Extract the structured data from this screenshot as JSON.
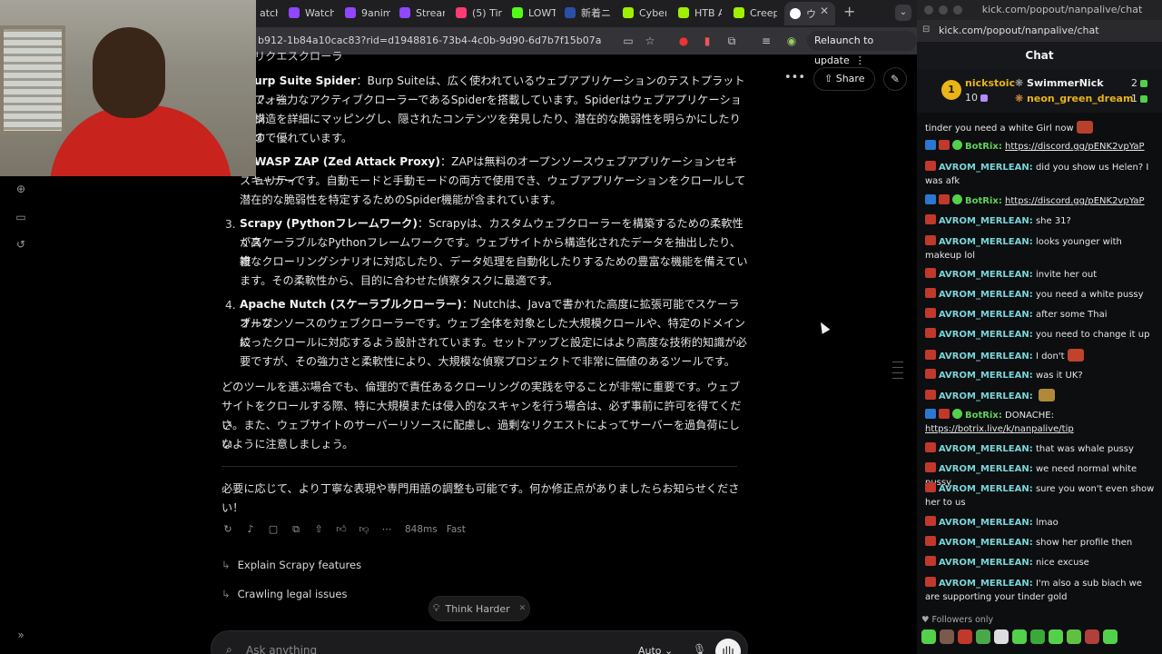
{
  "browser": {
    "tabs": [
      {
        "label": "atch",
        "icon": "youtube-icon",
        "color": "#ff0033"
      },
      {
        "label": "Watch",
        "icon": "twitch-icon",
        "color": "#9146ff"
      },
      {
        "label": "9anim",
        "icon": "twitch-icon",
        "color": "#9146ff"
      },
      {
        "label": "Stream",
        "icon": "twitch-icon",
        "color": "#9146ff"
      },
      {
        "label": "(5) Tir",
        "icon": "tinder-icon",
        "color": "#fe3c72"
      },
      {
        "label": "LOWT",
        "icon": "kick-icon",
        "color": "#53fc18"
      },
      {
        "label": "新着ニ",
        "icon": "news-icon",
        "color": "#2b4fa8"
      },
      {
        "label": "Cyber",
        "icon": "hackthebox-icon",
        "color": "#9fef00"
      },
      {
        "label": "HTB A",
        "icon": "hackthebox-icon",
        "color": "#9fef00"
      },
      {
        "label": "Creep",
        "icon": "hackthebox-icon",
        "color": "#9fef00"
      },
      {
        "label": "ウ",
        "icon": "grok-icon",
        "color": "#ffffff"
      }
    ],
    "url": "b912-1b84a10cac83?rid=d1948816-73b4-4c0b-9d90-6d7b7f15b07a",
    "relaunch_label": "Relaunch to update"
  },
  "conversation": {
    "share_label": "Share",
    "heading_fragment": "リクエスクローラ",
    "item1_title": "urp Suite Spider",
    "item1_lines": [
      "：Burp Suiteは、広く使われているウェブアプリケーションのテストプラットフォー",
      "で、強力なアクティブクローラーであるSpiderを搭載しています。Spiderはウェブアプリケーション",
      "構造を詳細にマッピングし、隠されたコンテンツを発見したり、潜在的な脆弱性を明らかにしたりす",
      "ので優れています。"
    ],
    "item2_title": "WASP ZAP (Zed Attack Proxy)",
    "item2_lines": [
      "：ZAPは無料のオープンソースウェブアプリケーションセキュリティ",
      "スキャナーです。自動モードと手動モードの両方で使用でき、ウェブアプリケーションをクロールして",
      "潜在的な脆弱性を特定するためのSpider機能が含まれています。"
    ],
    "item3_num": "3.",
    "item3_title": "Scrapy (Pythonフレームワーク)",
    "item3_lines": [
      "：Scrapyは、カスタムウェブクローラーを構築するための柔軟性が高",
      "くスケーラブルなPythonフレームワークです。ウェブサイトから構造化されたデータを抽出したり、複",
      "雑なクローリングシナリオに対応したり、データ処理を自動化したりするための豊富な機能を備えてい",
      "ます。その柔軟性から、目的に合わせた偵察タスクに最適です。"
    ],
    "item4_num": "4.",
    "item4_title": "Apache Nutch (スケーラブルクローラー)",
    "item4_lines": [
      "：Nutchは、Javaで書かれた高度に拡張可能でスケーラブルな",
      "オープンソースのウェブクローラーです。ウェブ全体を対象とした大規模クロールや、特定のドメインに",
      "絞ったクロールに対応するよう設計されています。セットアップと設定にはより高度な技術的知識が必",
      "要ですが、その強力さと柔軟性により、大規模な偵察プロジェクトで非常に価値のあるツールです。"
    ],
    "closing_lines": [
      "どのツールを選ぶ場合でも、倫理的で責任あるクローリングの実践を守ることが非常に重要です。ウェブ",
      "サイトをクロールする際、特に大規模または侵入的なスキャンを行う場合は、必ず事前に許可を得てくださ",
      "い。また、ウェブサイトのサーバーリソースに配慮し、過剰なリクエストによってサーバーを過負荷にしな",
      "いように注意しましょう。"
    ],
    "final_lines": [
      "必要に応じて、より丁寧な表現や専門用語の調整も可能です。何か修正点がありましたらお知らせくださ",
      "い！"
    ],
    "response_time": "848ms",
    "mode_label": "Fast",
    "followups": [
      "Explain Scrapy features",
      "Crawling legal issues"
    ],
    "think_harder_label": "Think Harder",
    "input_placeholder": "Ask anything",
    "model_mode": "Auto"
  },
  "kick": {
    "window_title": "kick.com/popout/nanpalive/chat",
    "url": "kick.com/popout/nanpalive/chat",
    "chat_title": "Chat",
    "gifters": {
      "rank_badge": "1",
      "top_name": "nickstoic",
      "top_count": "10",
      "second_name": "SwimmerNick",
      "second_count": "2",
      "third_name": "neon_green_dream",
      "third_count": "1"
    },
    "messages": [
      {
        "user": "",
        "text": "tinder you need a white Girl now",
        "emote": true,
        "badges": []
      },
      {
        "user": "BotRix:",
        "text": "",
        "link": "https://discord.gg/pENK2vpYaP",
        "bot": true
      },
      {
        "user": "AVROM_MERLEAN:",
        "text": "did you show us Helen? I was afk"
      },
      {
        "user": "BotRix:",
        "text": "",
        "link": "https://discord.gg/pENK2vpYaP",
        "bot": true
      },
      {
        "user": "AVROM_MERLEAN:",
        "text": "she 31?"
      },
      {
        "user": "AVROM_MERLEAN:",
        "text": "looks younger with makeup lol"
      },
      {
        "user": "AVROM_MERLEAN:",
        "text": "invite her out"
      },
      {
        "user": "AVROM_MERLEAN:",
        "text": "you need a white pussy"
      },
      {
        "user": "AVROM_MERLEAN:",
        "text": "after some Thai"
      },
      {
        "user": "AVROM_MERLEAN:",
        "text": "you need to change it up"
      },
      {
        "user": "AVROM_MERLEAN:",
        "text": "I don't",
        "emote": true
      },
      {
        "user": "AVROM_MERLEAN:",
        "text": "was it UK?"
      },
      {
        "user": "AVROM_MERLEAN:",
        "text": "",
        "emote": true
      },
      {
        "user": "BotRix:",
        "text": "DONACHE:",
        "link": "https://botrix.live/k/nanpalive/tip",
        "bot": true
      },
      {
        "user": "AVROM_MERLEAN:",
        "text": "that was whale pussy"
      },
      {
        "user": "AVROM_MERLEAN:",
        "text": "we need normal white pussy"
      },
      {
        "user": "AVROM_MERLEAN:",
        "text": "sure you won't even show her to us"
      },
      {
        "user": "AVROM_MERLEAN:",
        "text": "lmao"
      },
      {
        "user": "AVROM_MERLEAN:",
        "text": "show her profile then"
      },
      {
        "user": "AVROM_MERLEAN:",
        "text": "nice excuse"
      },
      {
        "user": "AVROM_MERLEAN:",
        "text": "I'm also a sub biach we are supporting your tinder gold"
      }
    ],
    "followers_only_label": "Followers only",
    "colors": {
      "avrom": "#79d4d8",
      "botrix": "#5fd15a",
      "gold": "#e8b418"
    }
  }
}
